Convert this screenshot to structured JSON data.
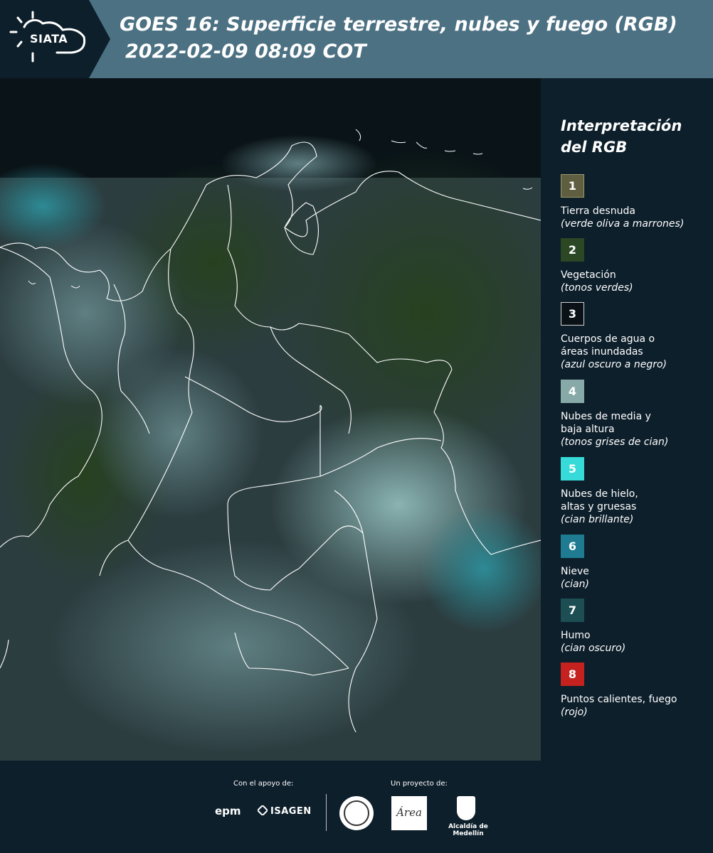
{
  "header": {
    "logo_text": "SIATA",
    "title_line1": "GOES 16: Superficie terrestre, nubes y fuego (RGB)",
    "title_line2": "2022-02-09 08:09 COT",
    "background_color": "#4c7183"
  },
  "legend": {
    "title_line1": "Interpretación",
    "title_line2": "del RGB",
    "items": [
      {
        "number": "1",
        "label": "Tierra desnuda",
        "sub": "(verde oliva a marrones)",
        "color": "#5f5e40"
      },
      {
        "number": "2",
        "label": "Vegetación",
        "sub": "(tonos verdes)",
        "color": "#2c4724"
      },
      {
        "number": "3",
        "label": "Cuerpos de agua o áreas inundadas",
        "sub": "(azul oscuro a negro)",
        "color": "#0a1217"
      },
      {
        "number": "4",
        "label": "Nubes de media y baja altura",
        "sub": "(tonos grises de cian)",
        "color": "#87aaa9"
      },
      {
        "number": "5",
        "label": "Nubes de hielo, altas y gruesas",
        "sub": "(cian brillante)",
        "color": "#36dbd9"
      },
      {
        "number": "6",
        "label": "Nieve",
        "sub": "(cian)",
        "color": "#1f7b92"
      },
      {
        "number": "7",
        "label": "Humo",
        "sub": "(cian oscuro)",
        "color": "#1c4e53"
      },
      {
        "number": "8",
        "label": "Puntos calientes, fuego",
        "sub": "(rojo)",
        "color": "#c5221f"
      }
    ]
  },
  "footer": {
    "support_label": "Con el apoyo de:",
    "project_label": "Un proyecto de:",
    "logo_epm": "epm",
    "logo_isagen": "ISAGEN",
    "logo_alcaldia": "Alcaldía de Medellín"
  }
}
